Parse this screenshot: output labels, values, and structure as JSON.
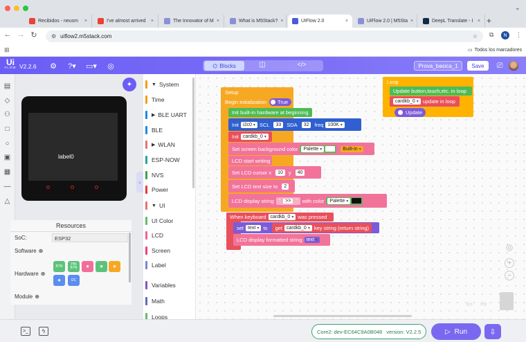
{
  "browser": {
    "tabs": [
      {
        "title": "Recibidos - neusm",
        "favicon": "gmail-icon"
      },
      {
        "title": "I've almost arrived",
        "favicon": "gmail-icon"
      },
      {
        "title": "The Innovator of M",
        "favicon": "m5-icon"
      },
      {
        "title": "What is M5Stack?",
        "favicon": "m5-icon"
      },
      {
        "title": "UIFlow 2.0",
        "favicon": "uiflow-icon",
        "active": true
      },
      {
        "title": "UiFlow 2.0 | M5Sta",
        "favicon": "m5-icon"
      },
      {
        "title": "DeepL Translate - I",
        "favicon": "deepl-icon"
      }
    ],
    "url": "uiflow2.m5stack.com",
    "bookmarks_label": "Todos los marcadores",
    "profile_initial": "N"
  },
  "app": {
    "logo_top": "Ui",
    "logo_bottom": "FLOW",
    "version": "V2.2.6",
    "view_tabs": {
      "blocks": "Blocks"
    },
    "project_name": "Prova_basica_1",
    "save_label": "Save"
  },
  "device": {
    "label": "label0"
  },
  "resources": {
    "title": "Resources",
    "soc_label": "SoC:",
    "soc_value": "ESP32",
    "software_label": "Software",
    "hardware_label": "Hardware",
    "module_label": "Module",
    "hw_badges": [
      "BTN",
      "PIN BTN",
      "",
      "",
      "",
      "",
      "I2C"
    ]
  },
  "palette": [
    {
      "label": "System",
      "color": "#f39c12",
      "arrow": "▼"
    },
    {
      "label": "Time",
      "color": "#f39c12",
      "arrow": ""
    },
    {
      "label": "BLE UART",
      "color": "#1e88e5",
      "arrow": "▶"
    },
    {
      "label": "BLE",
      "color": "#1e88e5",
      "arrow": ""
    },
    {
      "label": "WLAN",
      "color": "#e57373",
      "arrow": "▶"
    },
    {
      "label": "ESP-NOW",
      "color": "#26a69a",
      "arrow": ""
    },
    {
      "label": "NVS",
      "color": "#43a047",
      "arrow": ""
    },
    {
      "label": "Power",
      "color": "#e53935",
      "arrow": ""
    },
    {
      "label": "UI",
      "color": "#e57373",
      "arrow": "▼"
    },
    {
      "label": "UI Color",
      "color": "#66bb6a",
      "arrow": ""
    },
    {
      "label": "LCD",
      "color": "#f06292",
      "arrow": ""
    },
    {
      "label": "Screen",
      "color": "#ec407a",
      "arrow": ""
    },
    {
      "label": "Label",
      "color": "#7986cb",
      "arrow": ""
    },
    {
      "label": "Variables",
      "color": "#7e57c2",
      "arrow": ""
    },
    {
      "label": "Math",
      "color": "#5c6bc0",
      "arrow": ""
    },
    {
      "label": "Loops",
      "color": "#66bb6a",
      "arrow": ""
    }
  ],
  "blocks": {
    "setup": "Setup",
    "begin_init": "Begin initialization",
    "true_label": "True",
    "init_hw": "Init built-in hardware at beginning",
    "init": "Init",
    "i2c": "i2c0",
    "scl": "SCL",
    "scl_val": "33",
    "sda": "SDA",
    "sda_val": "32",
    "freq": "freq",
    "freq_val": "100K",
    "cardkb": "cardkb_0",
    "set_bg": "Set screen background color",
    "palette": "Palette",
    "builtin": "Built-in",
    "lcd_start": "LCD start writing",
    "set_cursor": "Set LCD cursor x",
    "x_val": "10",
    "y_label": "y",
    "y_val": "40",
    "set_size": "Set LCD text size to",
    "size_val": "2",
    "lcd_display": "LCD display string",
    "quote_open": "“",
    "display_text": ">>",
    "quote_close": "”",
    "with_color": "with color",
    "loop": "Loop",
    "update_btn": "Update button,touch,etc. in loop",
    "update_in_loop": "update in loop",
    "update": "Update",
    "when_kb": "When keyboard",
    "was_pressed": "was pressed",
    "set": "set",
    "text_var": "text",
    "to": "to",
    "get": "get",
    "key_string": "key string (return string)",
    "lcd_fmt": "LCD display formatted string"
  },
  "status": {
    "device": "Core2: dev-EC64C9A0B048",
    "version": "version: V2.2.5",
    "run_label": "Run"
  },
  "colors": {
    "header": "#6b5df5",
    "system": "#f7a823",
    "init": "#4dbb55",
    "i2c": "#2f5fd0",
    "lcd": "#f2739a",
    "loop": "#ffb300",
    "kb": "#e8505b",
    "var": "#7c5cd6"
  }
}
